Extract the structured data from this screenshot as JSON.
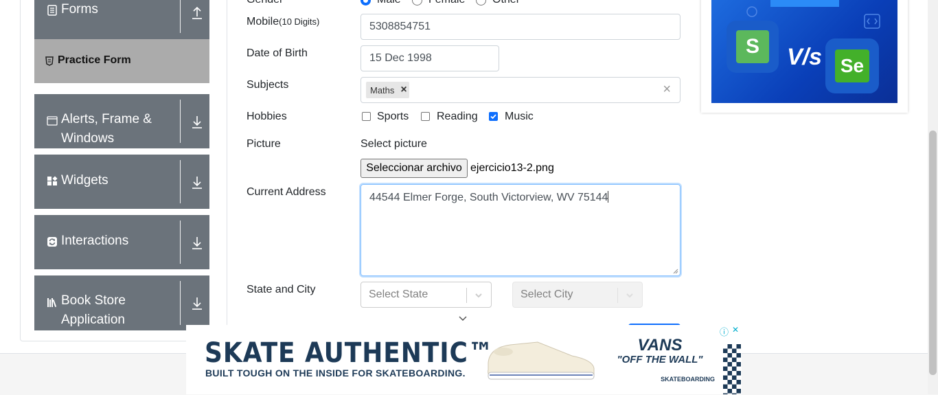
{
  "nav": {
    "forms_label": "Forms",
    "practice_form_label": "Practice Form",
    "alerts_label_line1": "Alerts, Frame &",
    "alerts_label_line2": "Windows",
    "widgets_label": "Widgets",
    "interactions_label": "Interactions",
    "bookstore_label_line1": "Book Store",
    "bookstore_label_line2": "Application"
  },
  "form": {
    "gender_label": "Gender",
    "gender_options": [
      "Male",
      "Female",
      "Other"
    ],
    "gender_selected": "Male",
    "mobile_label": "Mobile",
    "mobile_hint": "(10 Digits)",
    "mobile_value": "5308854751",
    "dob_label": "Date of Birth",
    "dob_value": "15 Dec 1998",
    "subjects_label": "Subjects",
    "subject_chip": "Maths",
    "chip_remove": "×",
    "clear_all": "×",
    "hobbies_label": "Hobbies",
    "hobbies": [
      {
        "label": "Sports",
        "checked": false
      },
      {
        "label": "Reading",
        "checked": false
      },
      {
        "label": "Music",
        "checked": true
      }
    ],
    "picture_label": "Picture",
    "select_picture": "Select picture",
    "file_button": "Seleccionar archivo",
    "file_name": "ejercicio13-2.png",
    "address_label": "Current Address",
    "address_value": "44544 Elmer Forge, South Victorview, WV 75144",
    "state_city_label": "State and City",
    "state_placeholder": "Select State",
    "city_placeholder": "Select City"
  },
  "ad_bottom": {
    "headline": "SKATE AUTHENTIC™",
    "subline": "BUILT TOUGH ON THE INSIDE FOR SKATEBOARDING.",
    "brand_line1": "VANS",
    "brand_line2": "\"OFF THE WALL\"",
    "brand_tag": "SKATEBOARDING",
    "info_icon": "ⓘ",
    "close_icon": "✕"
  },
  "ad_right": {
    "vs_text": "V/s",
    "left_logo": "S",
    "right_logo": "Se"
  },
  "colors": {
    "nav_bg": "#6b737b",
    "practice_bg": "#ababab",
    "accent": "#0d6efd",
    "ad_blue": "#1e6de0"
  }
}
